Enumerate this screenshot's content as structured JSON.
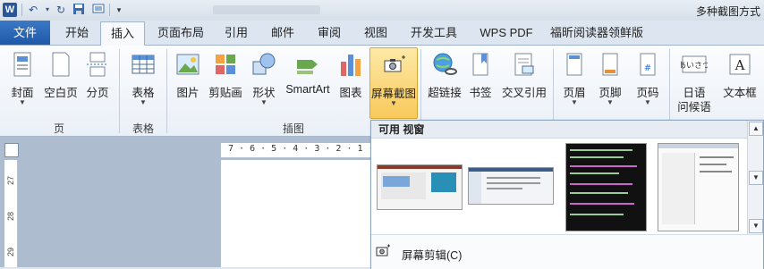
{
  "titlebar": {
    "app_icon": "W",
    "doc_title": "多种截图方式",
    "quick_access": [
      "undo-icon",
      "redo-icon",
      "save-icon",
      "screen-icon",
      "dropdown-icon"
    ]
  },
  "tabs": {
    "file": "文件",
    "items": [
      "开始",
      "插入",
      "页面布局",
      "引用",
      "邮件",
      "审阅",
      "视图",
      "开发工具",
      "WPS PDF",
      "福昕阅读器领鲜版"
    ],
    "active": "插入"
  },
  "ribbon": {
    "groups": {
      "page": {
        "label": "页",
        "buttons": [
          "封面",
          "空白页",
          "分页"
        ]
      },
      "table": {
        "label": "表格",
        "buttons": [
          "表格"
        ]
      },
      "illustrations": {
        "label": "插图",
        "buttons": [
          "图片",
          "剪贴画",
          "形状",
          "SmartArt",
          "图表",
          "屏幕截图"
        ]
      },
      "links": {
        "buttons": [
          "超链接",
          "书签",
          "交叉引用"
        ]
      },
      "header_footer": {
        "buttons": [
          "页眉",
          "页脚",
          "页码"
        ]
      },
      "text": {
        "buttons": [
          "日语",
          "文本框"
        ],
        "second_line": [
          "问候语"
        ]
      }
    }
  },
  "ruler": {
    "horizontal": "7 · 6 · 5 · 4 · 3 · 2 · 1 ·",
    "vertical": [
      "27",
      "28",
      "29"
    ]
  },
  "popup": {
    "header": "可用 视窗",
    "thumbnails": [
      "thumbnail-1",
      "thumbnail-2",
      "thumbnail-3",
      "thumbnail-4"
    ],
    "clip_label": "屏幕剪辑(C)"
  }
}
